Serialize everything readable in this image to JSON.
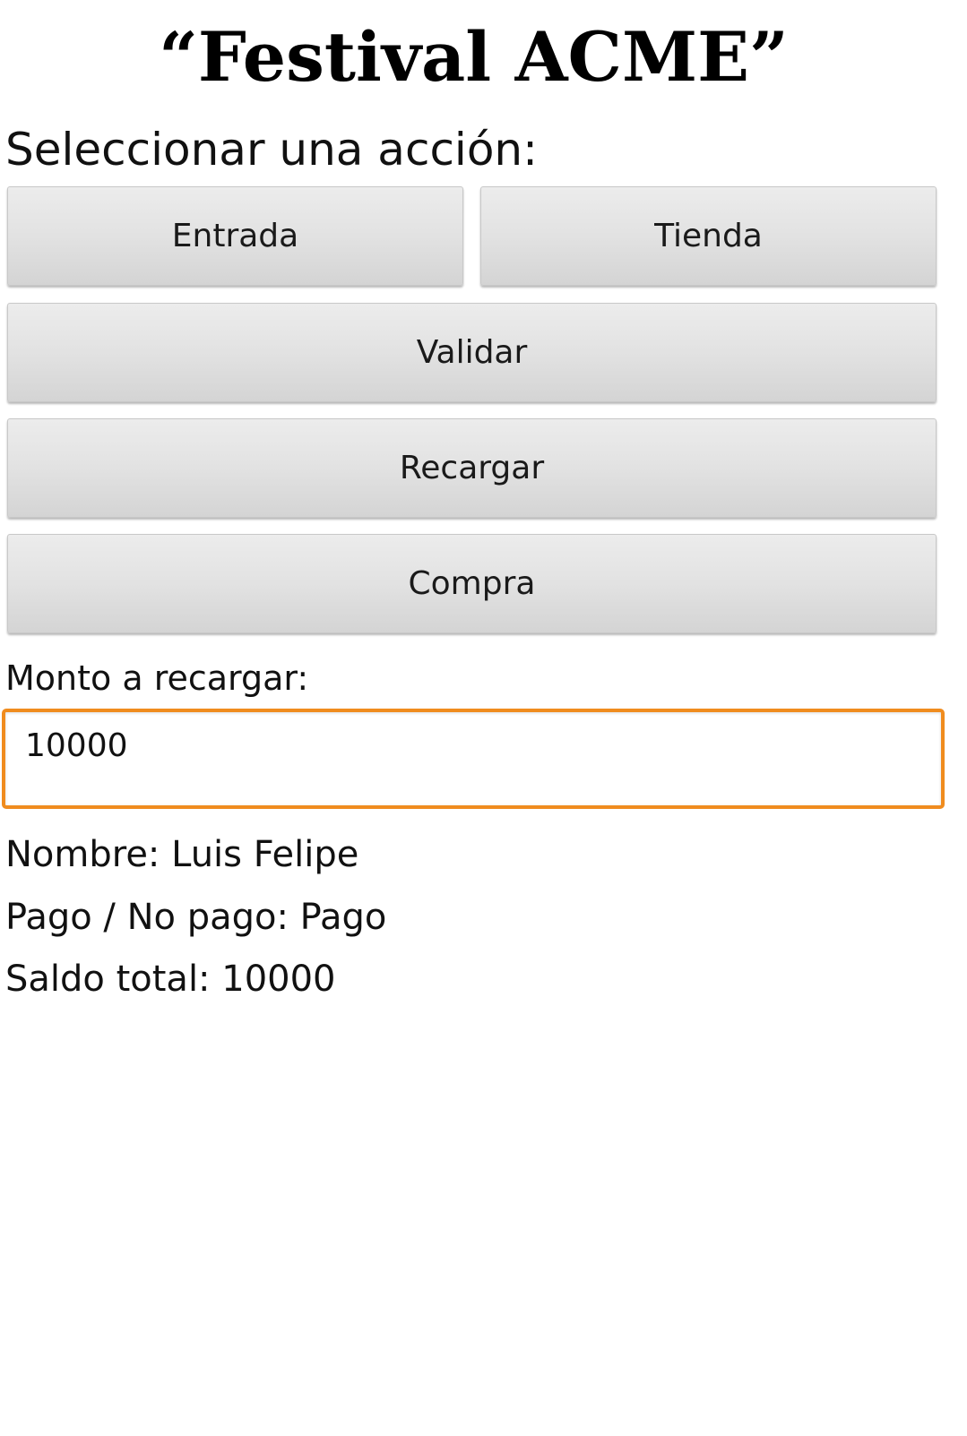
{
  "header": {
    "title": "“Festival ACME”"
  },
  "actions": {
    "prompt": "Seleccionar una acción:",
    "entrada_label": "Entrada",
    "tienda_label": "Tienda",
    "validar_label": "Validar",
    "recargar_label": "Recargar",
    "compra_label": "Compra"
  },
  "recharge": {
    "label": "Monto a recargar:",
    "value": "10000",
    "focus_color": "#f08c1e"
  },
  "info": {
    "nombre": "Nombre: Luis Felipe",
    "pago": "Pago / No pago: Pago",
    "saldo": "Saldo total: 10000"
  }
}
